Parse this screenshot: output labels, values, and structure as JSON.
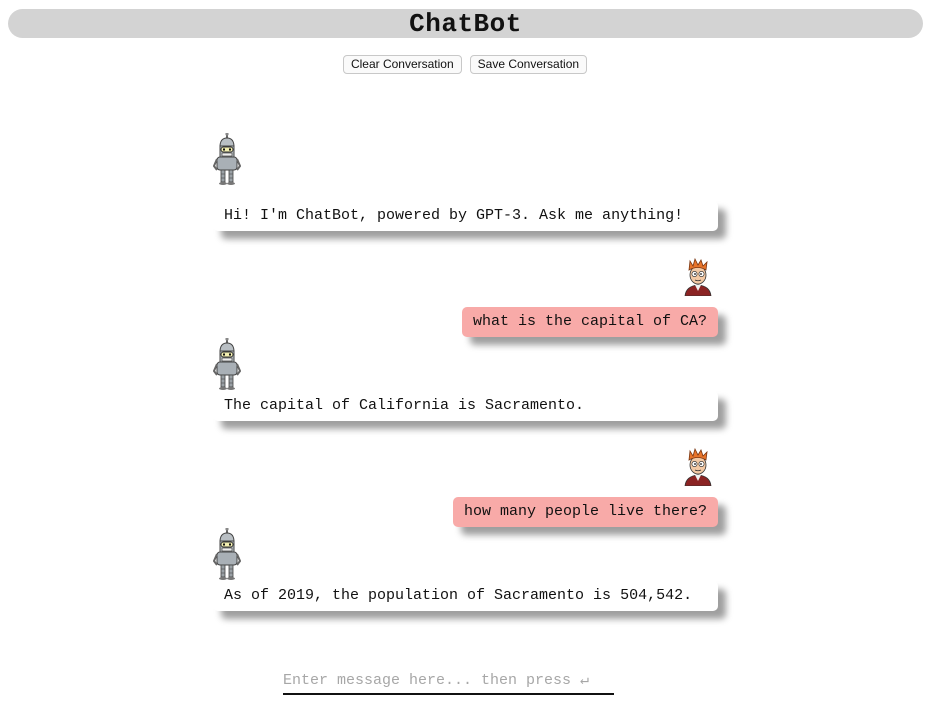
{
  "app": {
    "title": "ChatBot"
  },
  "toolbar": {
    "clear_label": "Clear Conversation",
    "save_label": "Save Conversation"
  },
  "messages": [
    {
      "role": "bot",
      "avatar": "robot-icon",
      "text": "Hi! I'm ChatBot, powered by GPT-3. Ask me anything!"
    },
    {
      "role": "user",
      "avatar": "user-avatar-icon",
      "text": "what is the capital of CA?"
    },
    {
      "role": "bot",
      "avatar": "robot-icon",
      "text": "The capital of California is Sacramento."
    },
    {
      "role": "user",
      "avatar": "user-avatar-icon",
      "text": "how many people live there?"
    },
    {
      "role": "bot",
      "avatar": "robot-icon",
      "text": "As of 2019, the population of Sacramento is 504,542."
    }
  ],
  "input": {
    "placeholder": "Enter message here... then press ↵",
    "value": ""
  },
  "colors": {
    "title_bar": "#d3d3d3",
    "user_bubble": "#f8aaa8",
    "bot_bubble": "#ffffff"
  }
}
